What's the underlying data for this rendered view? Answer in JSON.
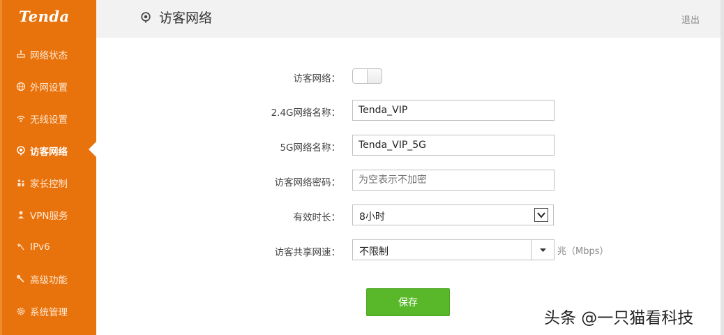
{
  "brand": {
    "logo": "Tenda"
  },
  "sidebar": {
    "items": [
      {
        "label": "网络状态",
        "icon": "network-status-icon",
        "active": false
      },
      {
        "label": "外网设置",
        "icon": "globe-icon",
        "active": false
      },
      {
        "label": "无线设置",
        "icon": "wifi-icon",
        "active": false
      },
      {
        "label": "访客网络",
        "icon": "guest-network-icon",
        "active": true
      },
      {
        "label": "家长控制",
        "icon": "parental-control-icon",
        "active": false
      },
      {
        "label": "VPN服务",
        "icon": "vpn-icon",
        "active": false
      },
      {
        "label": "IPv6",
        "icon": "ipv6-icon",
        "active": false
      },
      {
        "label": "高级功能",
        "icon": "wrench-icon",
        "active": false
      },
      {
        "label": "系统管理",
        "icon": "gear-icon",
        "active": false
      }
    ]
  },
  "header": {
    "title": "访客网络",
    "logout": "退出"
  },
  "form": {
    "guest_network_label": "访客网络：",
    "guest_network_enabled": false,
    "ssid_24g_label": "2.4G网络名称：",
    "ssid_24g_value": "Tenda_VIP",
    "ssid_5g_label": "5G网络名称：",
    "ssid_5g_value": "Tenda_VIP_5G",
    "password_label": "访客网络密码：",
    "password_placeholder": "为空表示不加密",
    "duration_label": "有效时长：",
    "duration_value": "8小时",
    "speed_label": "访客共享网速：",
    "speed_value": "不限制",
    "speed_unit": "兆（Mbps）",
    "save_label": "保存"
  },
  "watermark": "头条 @一只猫看科技",
  "colors": {
    "sidebar": "#e8720c",
    "save": "#58b82a",
    "header_bg": "#f2f2f2"
  }
}
